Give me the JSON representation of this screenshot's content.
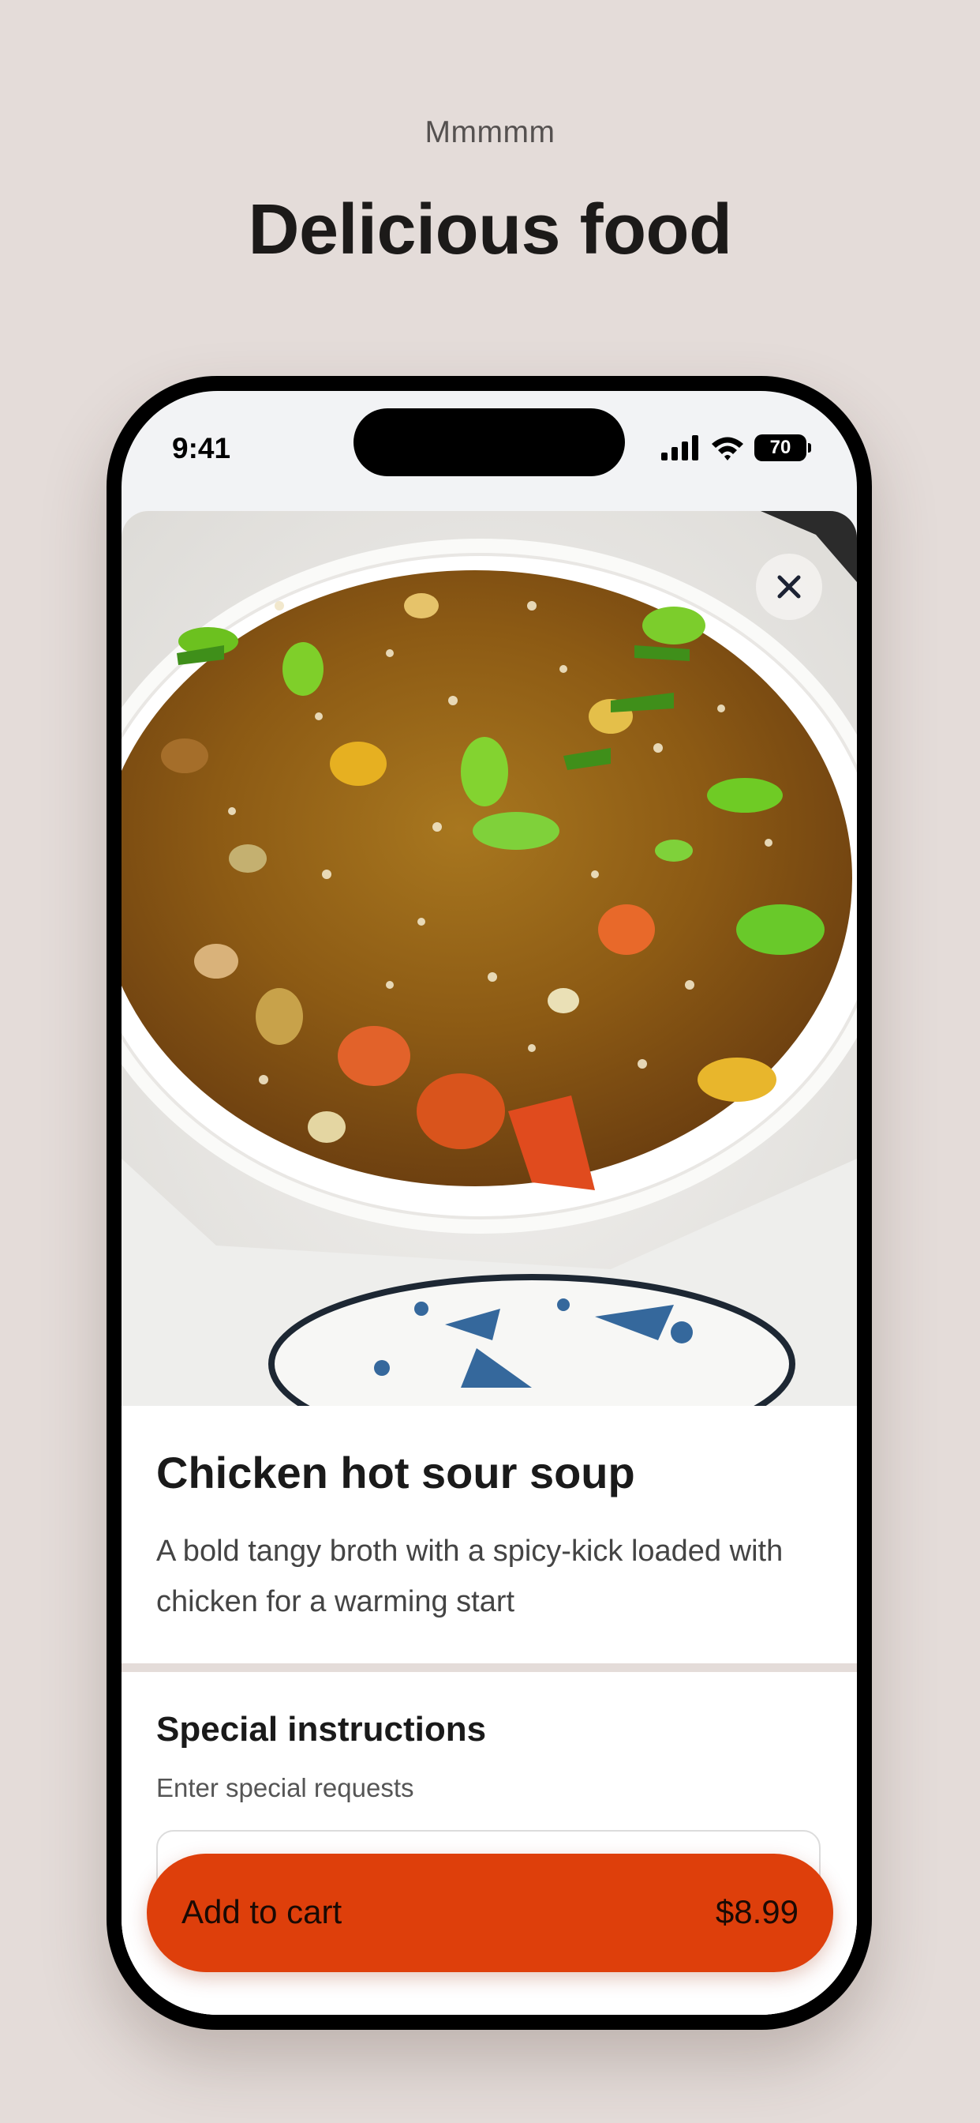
{
  "promo": {
    "eyebrow": "Mmmmm",
    "headline": "Delicious food"
  },
  "status_bar": {
    "time": "9:41",
    "battery": "70",
    "icons": [
      "cellular-signal-icon",
      "wifi-icon",
      "battery-icon"
    ]
  },
  "item": {
    "image_alt": "Bowl of chicken hot sour soup",
    "title": "Chicken hot sour soup",
    "description": "A bold tangy broth with a spicy-kick loaded with chicken for a warming start"
  },
  "instructions": {
    "title": "Special instructions",
    "subtitle": "Enter special requests",
    "value": ""
  },
  "cart": {
    "label": "Add to cart",
    "price": "$8.99"
  },
  "colors": {
    "background": "#e4dcd9",
    "accent": "#de3f0b",
    "soup_broth": "#8c5a14"
  }
}
